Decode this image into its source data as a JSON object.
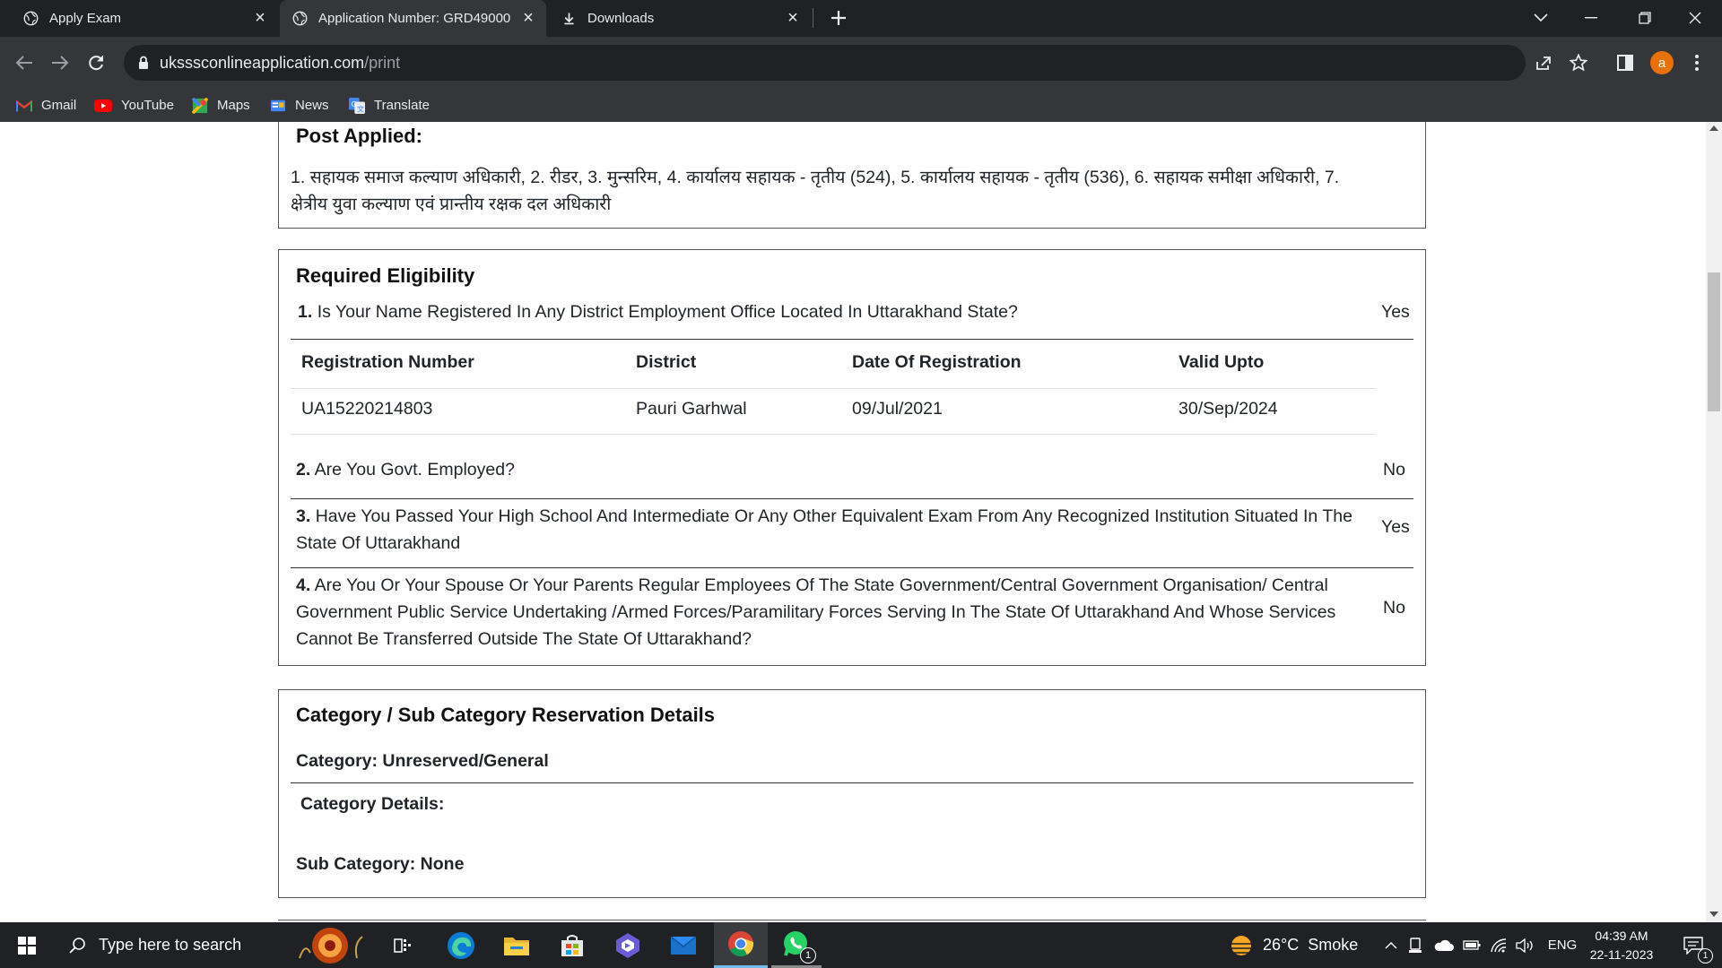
{
  "browser": {
    "tabs": [
      {
        "title": "Apply Exam"
      },
      {
        "title": "Application Number: GRD49000"
      },
      {
        "title": "Downloads"
      }
    ],
    "url_host": "uksssconlineapplication.com",
    "url_path": "/print",
    "profile_initial": "a",
    "bookmarks": [
      "Gmail",
      "YouTube",
      "Maps",
      "News",
      "Translate"
    ]
  },
  "post_applied": {
    "heading": "Post Applied:",
    "line1": "1. सहायक समाज कल्याण अधिकारी, 2. रीडर, 3. मुन्सरिम, 4. कार्यालय सहायक - तृतीय (524), 5. कार्यालय सहायक - तृतीय (536), 6. सहायक समीक्षा अधिकारी, 7.",
    "line2": "क्षेत्रीय युवा कल्याण एवं प्रान्तीय रक्षक दल अधिकारी"
  },
  "eligibility": {
    "heading": "Required Eligibility",
    "q1": {
      "num": "1.",
      "text": "Is Your Name Registered In Any District Employment Office Located In Uttarakhand State?",
      "answer": "Yes"
    },
    "reg_table": {
      "headers": [
        "Registration Number",
        "District",
        "Date Of Registration",
        "Valid Upto"
      ],
      "row": [
        "UA15220214803",
        "Pauri Garhwal",
        "09/Jul/2021",
        "30/Sep/2024"
      ]
    },
    "q2": {
      "num": "2.",
      "text": "Are You Govt. Employed?",
      "answer": "No"
    },
    "q3": {
      "num": "3.",
      "line1": "Have You Passed Your High School And Intermediate Or Any Other Equivalent Exam From Any Recognized Institution Situated In The",
      "line2": "State Of Uttarakhand",
      "answer": "Yes"
    },
    "q4": {
      "num": "4.",
      "line1": "Are You Or Your Spouse Or Your Parents Regular Employees Of The State Government/Central Government Organisation/ Central",
      "line2": "Government Public Service Undertaking /Armed Forces/Paramilitary Forces Serving In The State Of Uttarakhand And Whose Services",
      "line3": "Cannot Be Transferred Outside The State Of Uttarakhand?",
      "answer": "No"
    }
  },
  "category": {
    "heading": "Category / Sub Category Reservation Details",
    "category_line": "Category: Unreserved/General",
    "details_label": "Category Details:",
    "sub_category_line": "Sub Category: None"
  },
  "taskbar": {
    "search_placeholder": "Type here to search",
    "weather": "26°C  Smoke",
    "language": "ENG",
    "time": "04:39 AM",
    "date": "22-11-2023",
    "whatsapp_badge": "1",
    "notification_badge": "1"
  },
  "colors": {
    "chrome_dark": "#202124",
    "chrome_toolbar": "#35363a",
    "profile_orange": "#e8710a",
    "border": "#555555"
  }
}
